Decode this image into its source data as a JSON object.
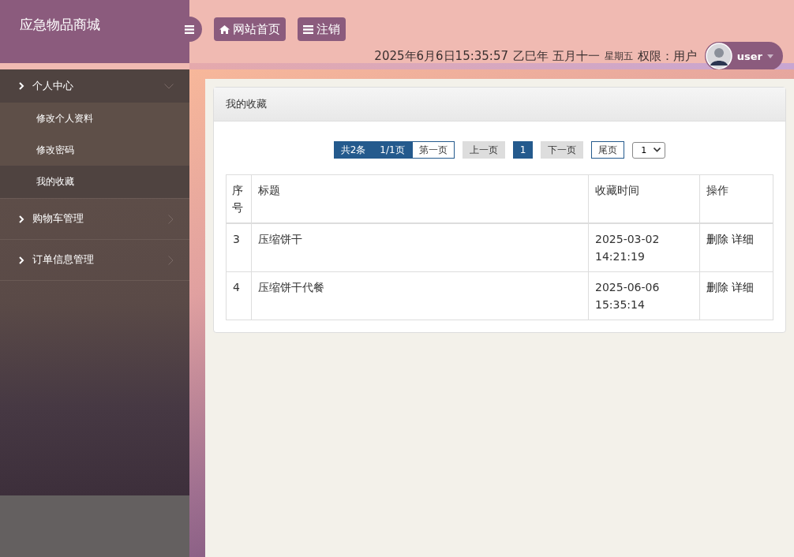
{
  "brand": "应急物品商城",
  "nav_buttons": [
    {
      "kind": "home",
      "label": "网站首页"
    },
    {
      "kind": "bars",
      "label": "注销"
    }
  ],
  "status": {
    "datetime": "2025年6月6日15:35:57",
    "lunar": "乙巳年 五月十一",
    "weekday": "星期五",
    "permission": "权限：用户"
  },
  "user": {
    "name": "user"
  },
  "sidebar": {
    "items": [
      {
        "label": "个人中心",
        "expanded": true,
        "children": [
          {
            "label": "修改个人资料",
            "selected": false
          },
          {
            "label": "修改密码",
            "selected": false
          },
          {
            "label": "我的收藏",
            "selected": true
          }
        ]
      },
      {
        "label": "购物车管理",
        "expanded": false
      },
      {
        "label": "订单信息管理",
        "expanded": false
      }
    ]
  },
  "panel": {
    "title": "我的收藏",
    "pager": [
      {
        "kind": "info",
        "label": "共2条"
      },
      {
        "kind": "info",
        "label": "1/1页"
      },
      {
        "kind": "link",
        "label": "第一页"
      },
      {
        "kind": "disabled",
        "label": "上一页"
      },
      {
        "kind": "current",
        "label": "1"
      },
      {
        "kind": "disabled",
        "label": "下一页"
      },
      {
        "kind": "link",
        "label": "尾页"
      }
    ],
    "page_select": "1",
    "table": {
      "columns": [
        "序号",
        "标题",
        "收藏时间",
        "操作"
      ],
      "rows": [
        {
          "id": "3",
          "title": "压缩饼干",
          "time": "2025-03-02 14:21:19",
          "actions": [
            "删除",
            "详细"
          ]
        },
        {
          "id": "4",
          "title": "压缩饼干代餐",
          "time": "2025-06-06 15:35:14",
          "actions": [
            "删除",
            "详细"
          ]
        }
      ]
    }
  }
}
